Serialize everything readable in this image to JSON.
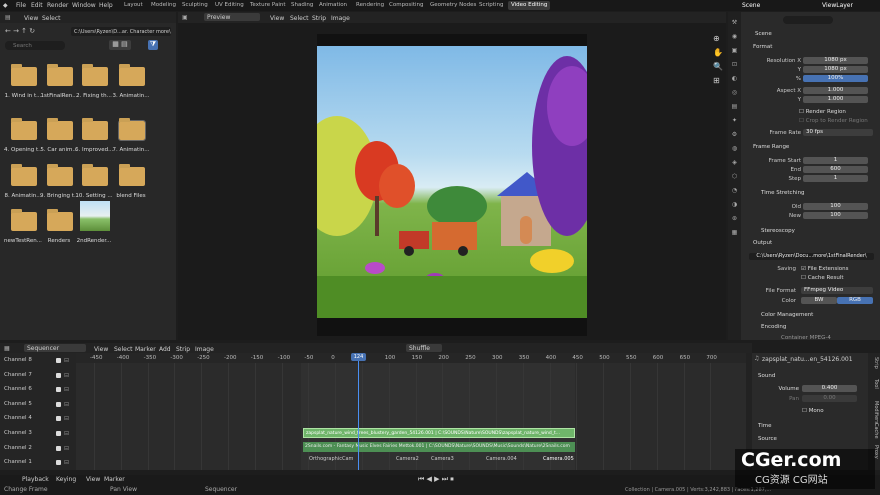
{
  "menu": [
    "File",
    "Edit",
    "Render",
    "Window",
    "Help"
  ],
  "workspaces": [
    "Layout",
    "Modeling",
    "Sculpting",
    "UV Editing",
    "Texture Paint",
    "Shading",
    "Animation",
    "Rendering",
    "Compositing",
    "Geometry Nodes",
    "Scripting",
    "Video Editing"
  ],
  "active_workspace": "Video Editing",
  "scene": "Scene",
  "view_layer": "ViewLayer",
  "filebrowser": {
    "menu": [
      "View",
      "Select"
    ],
    "path": "C:\\Users\\Ryzen\\D...ar. Character more\\",
    "search_placeholder": "Search",
    "items": [
      "1. Wind in t...",
      "1stFinalRen...",
      "2. Fixing th...",
      "3. Animatin...",
      "4. Opening t...",
      "5. Car anim...",
      "6. Improved...",
      "7. Animatin...",
      "8. Animatin...",
      "9. Bringing t...",
      "10. Setting ...",
      "blend Files",
      "newTestRen...",
      "Renders",
      "2ndRender..."
    ]
  },
  "preview": {
    "mode": "Preview",
    "menu": [
      "View",
      "Select",
      "Strip",
      "Image"
    ]
  },
  "props": {
    "format_title": "Format",
    "res_x_label": "Resolution X",
    "res_x": "1080 px",
    "y_label": "Y",
    "res_y": "1080 px",
    "pct_label": "%",
    "pct": "100%",
    "aspect_x_label": "Aspect X",
    "aspect_x": "1.000",
    "aspect_y_label": "Y",
    "aspect_y": "1.000",
    "render_region": "Render Region",
    "crop": "Crop to Render Region",
    "frame_rate_label": "Frame Rate",
    "frame_rate": "30 fps",
    "frame_range": "Frame Range",
    "fs_label": "Frame Start",
    "fs": "1",
    "end_label": "End",
    "end": "600",
    "step_label": "Step",
    "step": "1",
    "time_stretching": "Time Stretching",
    "old_label": "Old",
    "old": "100",
    "new_label": "New",
    "new": "100",
    "stereoscopy": "Stereoscopy",
    "output": "Output",
    "output_path": "C:\\Users\\Ryzen\\Docu...more\\1stFinalRender\\",
    "saving_label": "Saving",
    "file_ext": "File Extensions",
    "cache": "Cache Result",
    "file_format_label": "File Format",
    "file_format": "FFmpeg Video",
    "color_label": "Color",
    "bw": "BW",
    "rgb": "RGB",
    "color_mgmt": "Color Management",
    "encoding": "Encoding",
    "container": "Container  MPEG-4"
  },
  "sequencer": {
    "mode": "Sequencer",
    "menu": [
      "View",
      "Select",
      "Marker",
      "Add",
      "Strip",
      "Image"
    ],
    "shuffle": "Shuffle",
    "channels": [
      "Channel 8",
      "Channel 7",
      "Channel 6",
      "Channel 5",
      "Channel 4",
      "Channel 3",
      "Channel 2",
      "Channel 1"
    ],
    "ticks": [
      "-450",
      "-400",
      "-350",
      "-300",
      "-250",
      "-200",
      "-150",
      "-100",
      "-50",
      "0",
      "50",
      "100",
      "150",
      "200",
      "250",
      "300",
      "350",
      "400",
      "450",
      "500",
      "550",
      "600",
      "650",
      "700"
    ],
    "current_frame": "124",
    "strip_video": "zapsplat_nature_wind_trees_blustery_garden_54126.001 | C:\\SOUNDS\\Nature\\SOUNDS\\zapsplat_nature_wind_t...",
    "strip_audio": "2Snails.com - Fantasy Music Elves Fairies Mettok.001 | C:\\SOUNDS\\Nature\\SOUNDS\\Music\\Sounds\\Nature\\2Snails.com",
    "markers": [
      "OrthographicCam",
      "Camera2",
      "Camera3",
      "Camera.004",
      "Camera.005"
    ]
  },
  "seqside": {
    "strip_name": "zapsplat_natu...en_54126.001",
    "sound": "Sound",
    "volume_label": "Volume",
    "volume": "0.400",
    "pan_label": "Pan",
    "pan": "0.00",
    "mono": "Mono",
    "time": "Time",
    "source": "Source",
    "tabs": [
      "Strip",
      "Tool",
      "Modifiers",
      "Cache",
      "Proxy"
    ]
  },
  "status": {
    "left": "Change Frame",
    "playback": "Playback",
    "keying": "Keying",
    "view": "View",
    "marker": "Marker",
    "pan": "Pan View",
    "seq": "Sequencer",
    "right": "Collection | Camera.005 | Verts:3,242,883 | Faces:1,287,... "
  },
  "watermark": {
    "main": "CGer.com",
    "sub": "CG资源 CG网站"
  }
}
